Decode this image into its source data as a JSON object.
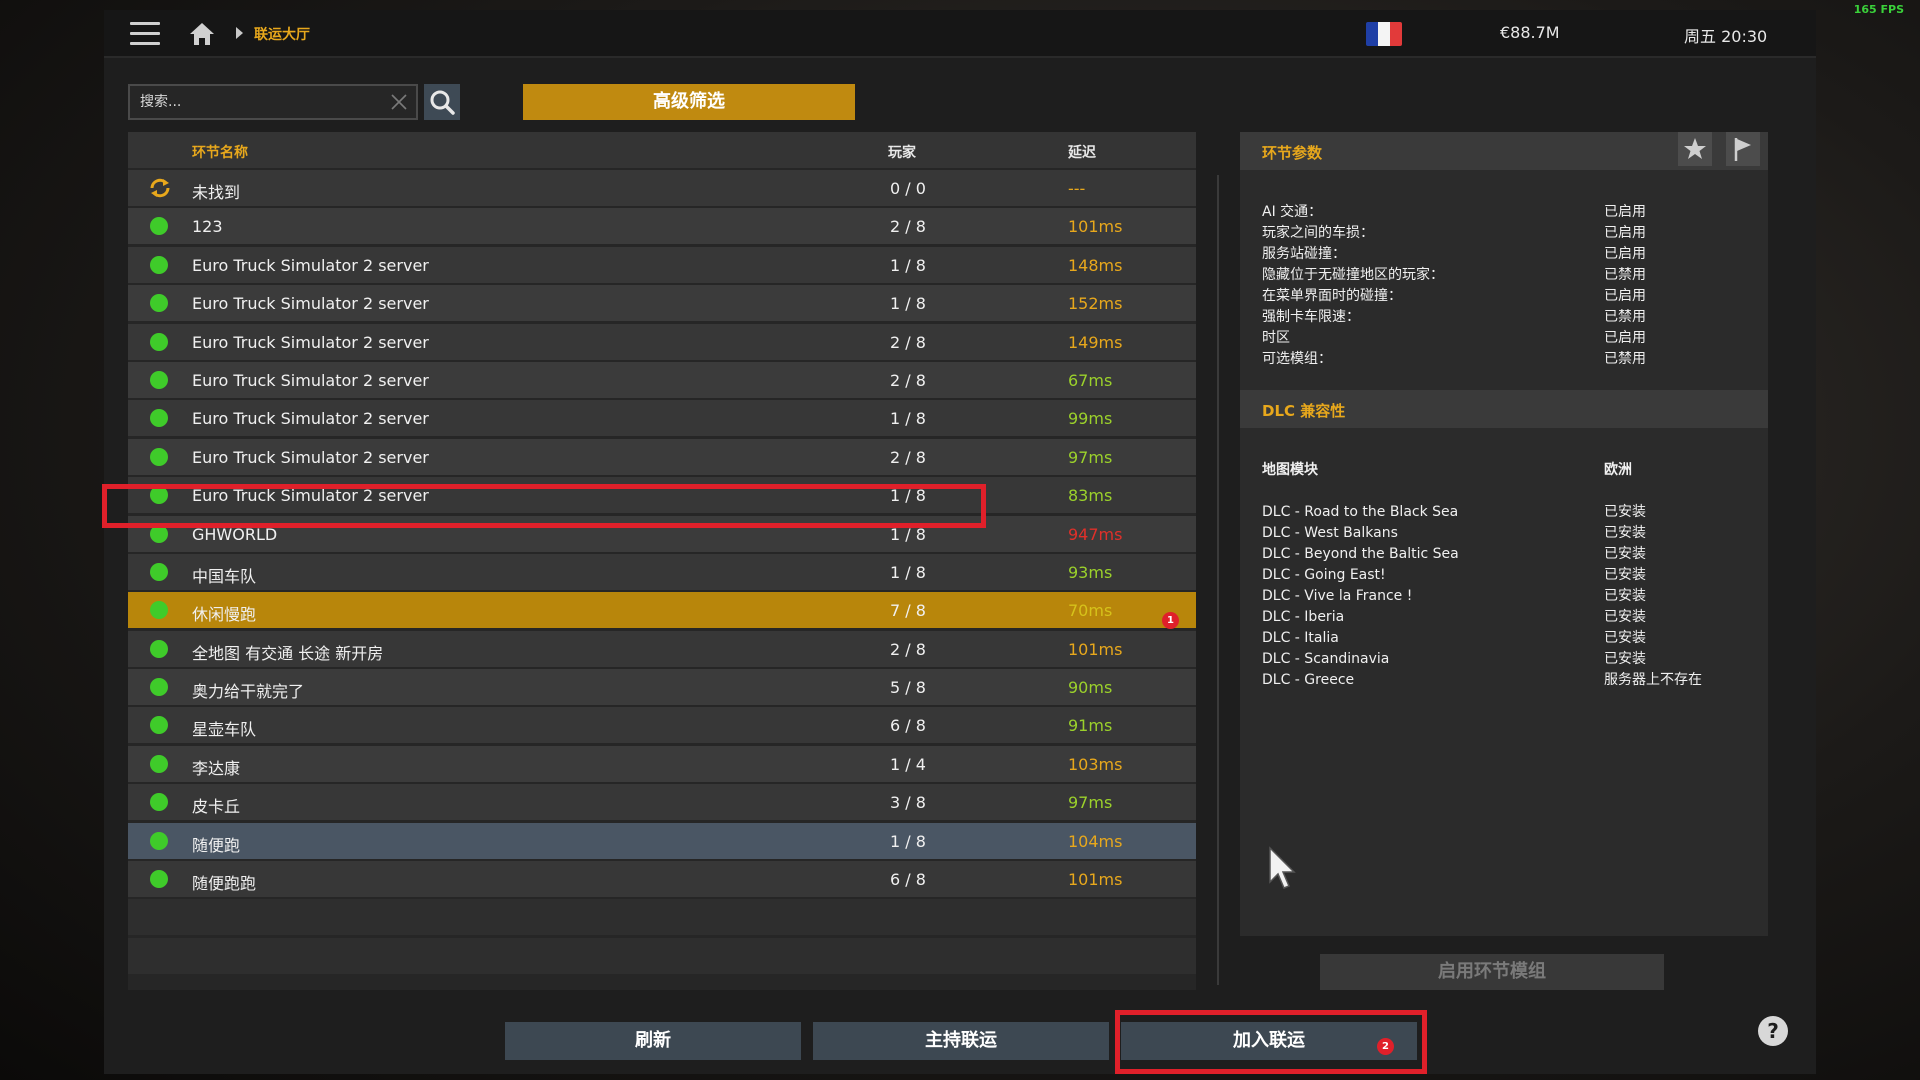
{
  "fps": "165 FPS",
  "topbar": {
    "breadcrumb": "联运大厅",
    "money": "€88.7M",
    "clock": "周五 20:30"
  },
  "search": {
    "placeholder": "搜索..."
  },
  "filter_label": "高级筛选",
  "list": {
    "headers": {
      "name": "环节名称",
      "players": "玩家",
      "ping": "延迟"
    },
    "rows": [
      {
        "name": "未找到",
        "players": "0 / 0",
        "ping": "---",
        "ping_color": "#e8a81c",
        "status": "refresh"
      },
      {
        "name": "123",
        "players": "2 / 8",
        "ping": "101ms",
        "ping_color": "#e8a81c",
        "status": "online"
      },
      {
        "name": "Euro Truck Simulator 2 server",
        "players": "1 / 8",
        "ping": "148ms",
        "ping_color": "#e8a81c",
        "status": "online"
      },
      {
        "name": "Euro Truck Simulator 2 server",
        "players": "1 / 8",
        "ping": "152ms",
        "ping_color": "#e8a81c",
        "status": "online"
      },
      {
        "name": "Euro Truck Simulator 2 server",
        "players": "2 / 8",
        "ping": "149ms",
        "ping_color": "#e8a81c",
        "status": "online"
      },
      {
        "name": "Euro Truck Simulator 2 server",
        "players": "2 / 8",
        "ping": "67ms",
        "ping_color": "#9bd12b",
        "status": "online"
      },
      {
        "name": "Euro Truck Simulator 2 server",
        "players": "1 / 8",
        "ping": "99ms",
        "ping_color": "#9bd12b",
        "status": "online"
      },
      {
        "name": "Euro Truck Simulator 2 server",
        "players": "2 / 8",
        "ping": "97ms",
        "ping_color": "#9bd12b",
        "status": "online"
      },
      {
        "name": "Euro Truck Simulator 2 server",
        "players": "1 / 8",
        "ping": "83ms",
        "ping_color": "#9bd12b",
        "status": "online"
      },
      {
        "name": "GHWORLD",
        "players": "1 / 8",
        "ping": "947ms",
        "ping_color": "#e0302a",
        "status": "online"
      },
      {
        "name": "中国车队",
        "players": "1 / 8",
        "ping": "93ms",
        "ping_color": "#9bd12b",
        "status": "online"
      },
      {
        "name": "休闲慢跑",
        "players": "7 / 8",
        "ping": "70ms",
        "ping_color": "#d6c21a",
        "status": "online",
        "selected": true
      },
      {
        "name": "全地图 有交通 长途 新开房",
        "players": "2 / 8",
        "ping": "101ms",
        "ping_color": "#e8a81c",
        "status": "online"
      },
      {
        "name": "奥力给干就完了",
        "players": "5 / 8",
        "ping": "90ms",
        "ping_color": "#9bd12b",
        "status": "online"
      },
      {
        "name": "星壶车队",
        "players": "6 / 8",
        "ping": "91ms",
        "ping_color": "#9bd12b",
        "status": "online"
      },
      {
        "name": "李达康",
        "players": "1 / 4",
        "ping": "103ms",
        "ping_color": "#e8a81c",
        "status": "online"
      },
      {
        "name": "皮卡丘",
        "players": "3 / 8",
        "ping": "97ms",
        "ping_color": "#9bd12b",
        "status": "online"
      },
      {
        "name": "随便跑",
        "players": "1 / 8",
        "ping": "104ms",
        "ping_color": "#e8a81c",
        "status": "online",
        "hover": true
      },
      {
        "name": "随便跑跑",
        "players": "6 / 8",
        "ping": "101ms",
        "ping_color": "#e8a81c",
        "status": "online"
      }
    ]
  },
  "params": {
    "title": "环节参数",
    "items": [
      {
        "k": "AI 交通：",
        "v": "已启用"
      },
      {
        "k": "玩家之间的车损：",
        "v": "已启用"
      },
      {
        "k": "服务站碰撞：",
        "v": "已启用"
      },
      {
        "k": "隐藏位于无碰撞地区的玩家：",
        "v": "已禁用"
      },
      {
        "k": "在菜单界面时的碰撞：",
        "v": "已启用"
      },
      {
        "k": "强制卡车限速：",
        "v": "已禁用"
      },
      {
        "k": "时区",
        "v": "已启用"
      },
      {
        "k": "可选模组：",
        "v": "已禁用"
      }
    ]
  },
  "dlc": {
    "title": "DLC 兼容性",
    "map_label": "地图模块",
    "map_value": "欧洲",
    "items": [
      {
        "k": "DLC - Road to the Black Sea",
        "v": "已安装"
      },
      {
        "k": "DLC - West Balkans",
        "v": "已安装"
      },
      {
        "k": "DLC - Beyond the Baltic Sea",
        "v": "已安装"
      },
      {
        "k": "DLC - Going East!",
        "v": "已安装"
      },
      {
        "k": "DLC - Vive la France !",
        "v": "已安装"
      },
      {
        "k": "DLC - Iberia",
        "v": "已安装"
      },
      {
        "k": "DLC - Italia",
        "v": "已安装"
      },
      {
        "k": "DLC - Scandinavia",
        "v": "已安装"
      },
      {
        "k": "DLC - Greece",
        "v": "服务器上不存在"
      }
    ]
  },
  "enable_mods_label": "启用环节模组",
  "buttons": {
    "refresh": "刷新",
    "host": "主持联运",
    "join": "加入联运"
  },
  "annotations": {
    "badge1": "1",
    "badge2": "2"
  },
  "help": "?",
  "colors": {
    "accent": "#e8a81c",
    "selected_row": "#b8860b",
    "online_dot": "#3fcb2a",
    "annotation": "#e0202a"
  }
}
